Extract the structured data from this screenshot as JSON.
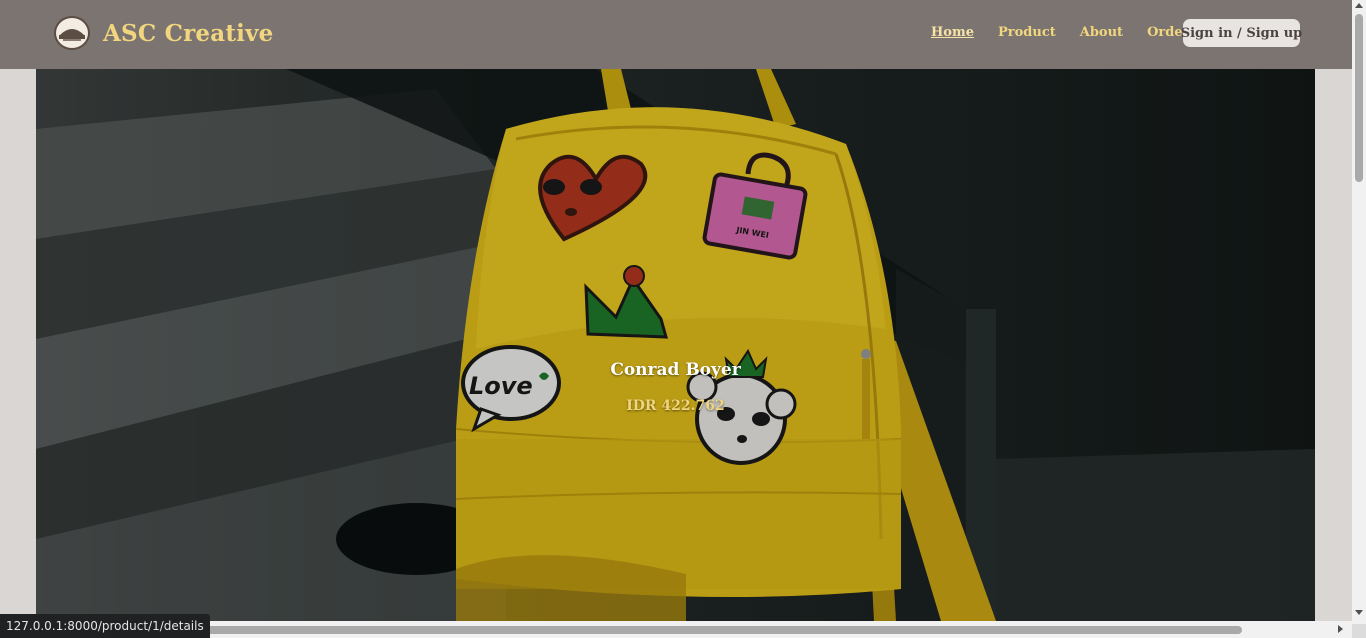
{
  "nav": {
    "brand": "ASC Creative",
    "links": [
      "Home",
      "Product",
      "About",
      "Order"
    ],
    "active": "Home",
    "signin": "Sign in / Sign up"
  },
  "hero": {
    "product_name": "Conrad Boyer",
    "price": "IDR 422.762",
    "patch_text": "Love",
    "patch_text_small": "JIN WEI"
  },
  "status_bar": {
    "url": "127.0.0.1:8000/product/1/details"
  },
  "colors": {
    "navbar": "#7c7470",
    "accent": "#f1d67f",
    "bag": "#e4c01a"
  }
}
